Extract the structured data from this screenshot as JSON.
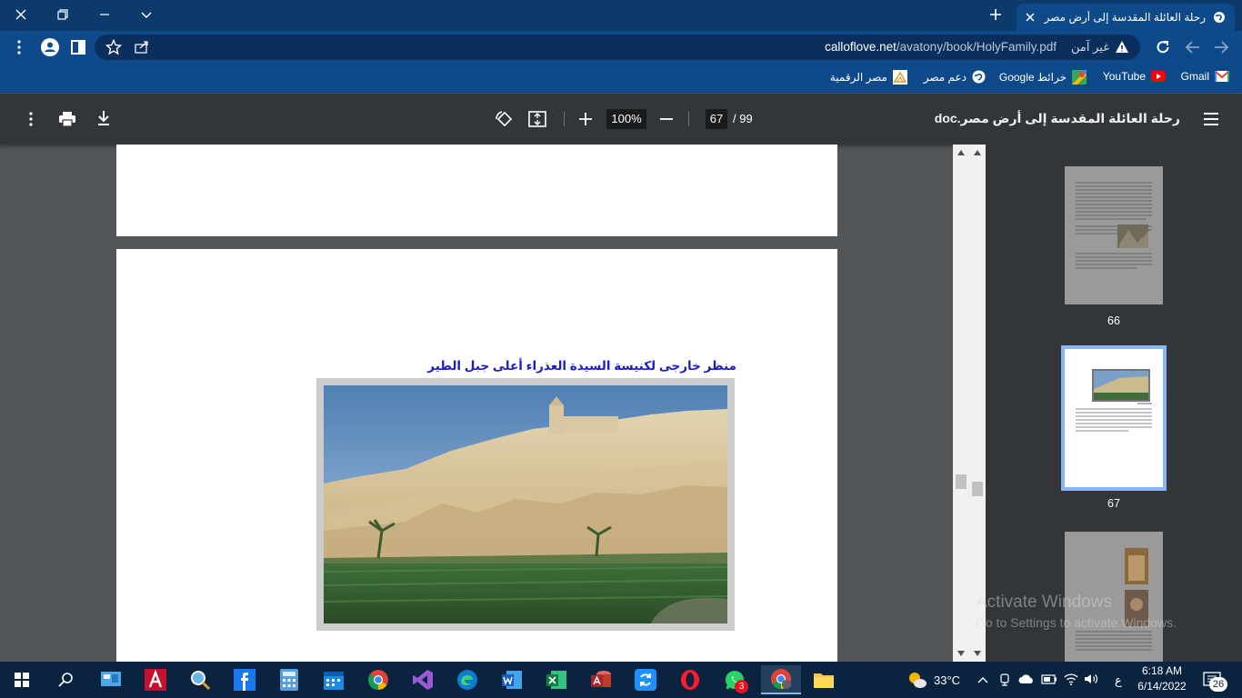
{
  "browser": {
    "tab_title": "رحلة العائلة المقدسة إلى أرض مصر",
    "security_text": "غير آمن",
    "url_host": "calloflove.net",
    "url_path": "/avatony/book/HolyFamily.pdf",
    "colors": {
      "titlebar": "#0b3a6b",
      "toolbar": "#0e4a8a"
    }
  },
  "bookmarks": [
    {
      "label": "Gmail",
      "icon": "gmail-icon"
    },
    {
      "label": "YouTube",
      "icon": "youtube-icon"
    },
    {
      "label": "خرائط Google",
      "icon": "maps-icon"
    },
    {
      "label": "دعم مصر",
      "icon": "globe-icon"
    },
    {
      "label": "مصر الرقمية",
      "icon": "digital-egypt-icon"
    }
  ],
  "pdf": {
    "document_title": "رحلة العائلة المقدسة إلى أرض مصر.doc",
    "current_page": "67",
    "total_pages": "/ 99",
    "zoom": "100%",
    "caption": "منظر خارجى لكنيسة السيدة العذراء أعلى جبل الطير",
    "thumbnails": [
      {
        "label": "66"
      },
      {
        "label": "67"
      },
      {
        "label": ""
      }
    ]
  },
  "watermark": {
    "line1": "Activate Windows",
    "line2": "Go to Settings to activate Windows."
  },
  "taskbar": {
    "weather": "33°C",
    "time": "6:18 AM",
    "date": "6/14/2022",
    "lang": "ع",
    "notifications": "26",
    "whatsapp_badge": "3"
  }
}
